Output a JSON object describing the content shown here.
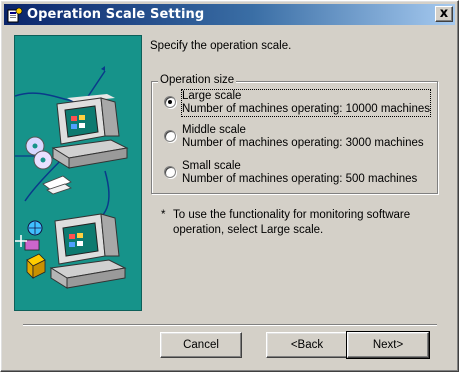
{
  "window": {
    "title": "Operation Scale Setting",
    "close_label": "x"
  },
  "prompt": "Specify the operation scale.",
  "operation_size": {
    "legend": "Operation size",
    "options": [
      {
        "title": "Large scale",
        "description": "Number of machines operating: 10000 machines",
        "selected": true
      },
      {
        "title": "Middle scale",
        "description": "Number of machines operating: 3000 machines",
        "selected": false
      },
      {
        "title": "Small scale",
        "description": "Number of machines operating: 500 machines",
        "selected": false
      }
    ]
  },
  "note": {
    "marker": "*",
    "text": "To use the functionality for monitoring software operation, select Large scale."
  },
  "buttons": {
    "cancel": "Cancel",
    "back": "<Back",
    "next": "Next>"
  },
  "colors": {
    "title_gradient_start": "#0a246a",
    "title_gradient_end": "#a6caf0",
    "dialog_face": "#d4d0c8",
    "art_background": "#16938a"
  }
}
